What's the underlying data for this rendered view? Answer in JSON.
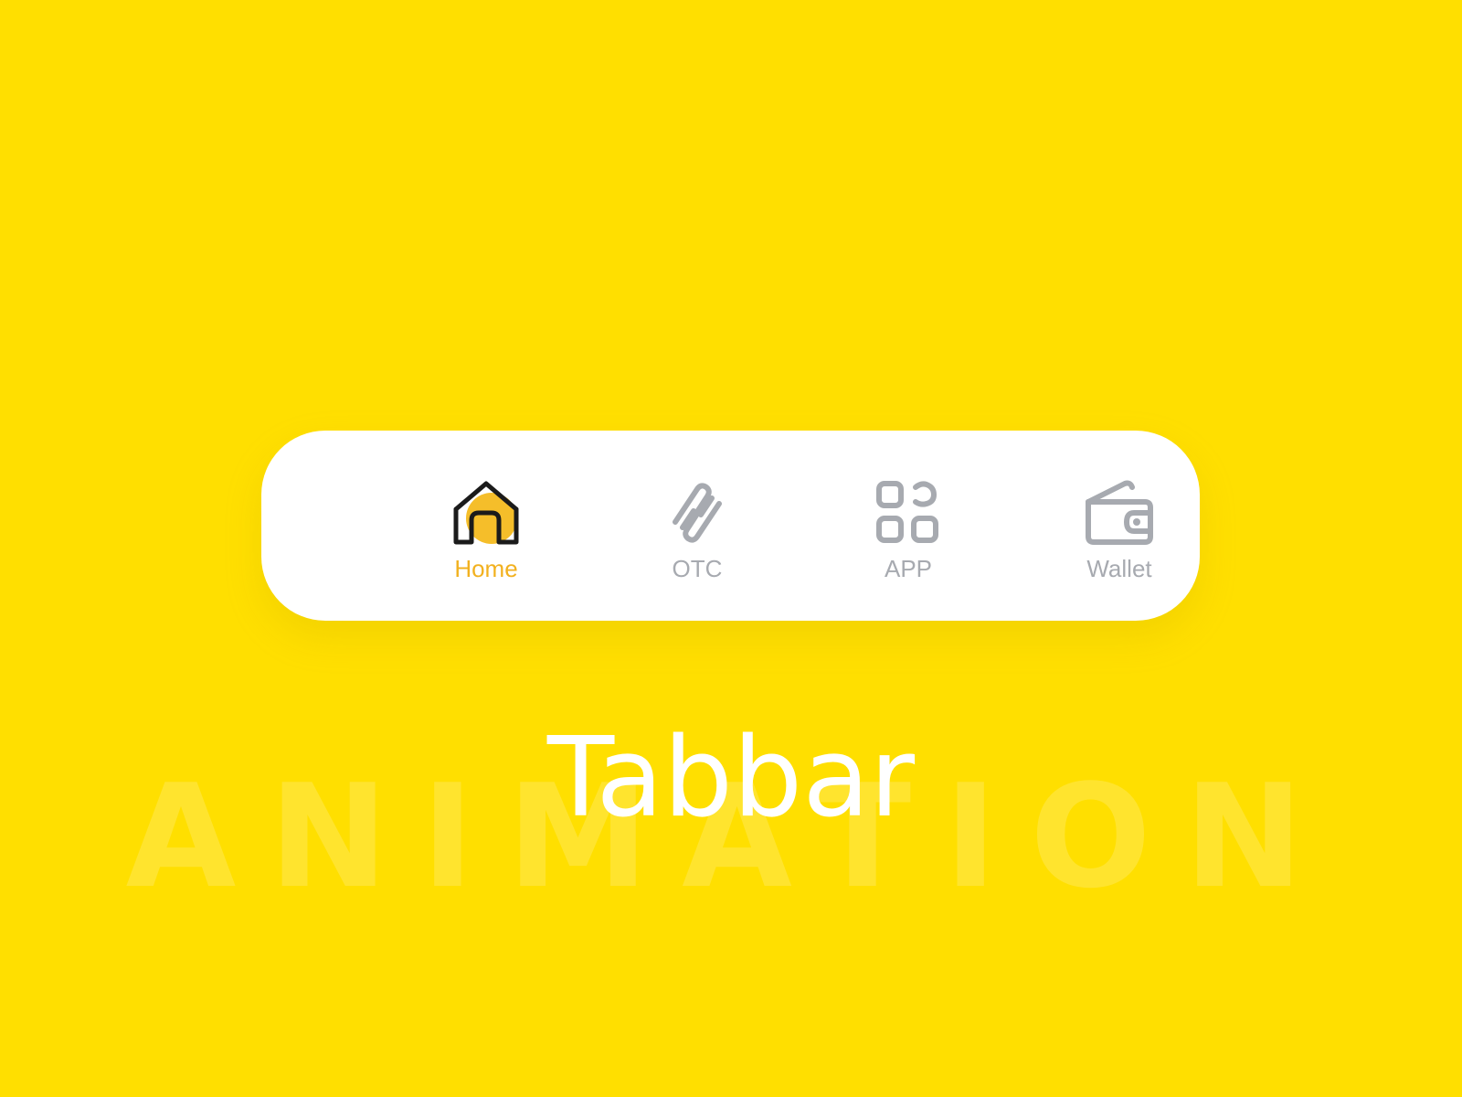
{
  "theme": {
    "background": "#FFDF00",
    "tabbar_background": "#FFFFFF",
    "active_color": "#F2B11F",
    "inactive_color": "#A7AAB0",
    "icon_active_stroke": "#1B1B1B"
  },
  "tabbar": {
    "active_tab": "Home",
    "tabs": [
      {
        "label": "Home",
        "icon": "home-icon",
        "active": true
      },
      {
        "label": "OTC",
        "icon": "otc-icon",
        "active": false
      },
      {
        "label": "APP",
        "icon": "apps-grid-icon",
        "active": false
      },
      {
        "label": "Wallet",
        "icon": "wallet-icon",
        "active": false
      }
    ]
  },
  "headline": {
    "title": "Tabbar",
    "background_word": "ANIMATION"
  }
}
